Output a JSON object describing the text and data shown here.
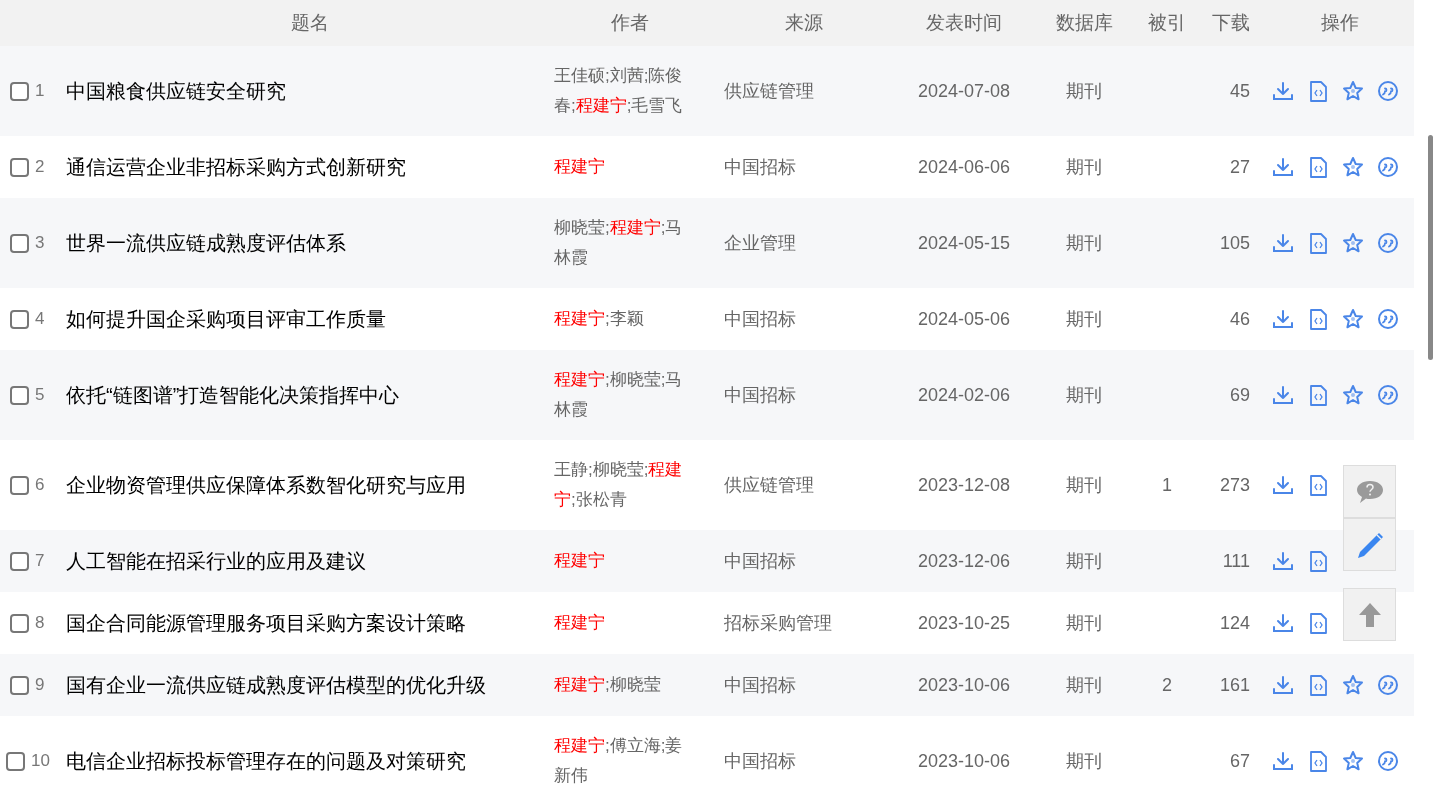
{
  "table": {
    "columns": [
      "题名",
      "作者",
      "来源",
      "发表时间",
      "数据库",
      "被引",
      "下载",
      "操作"
    ],
    "rows": [
      {
        "number": "1",
        "checked": false,
        "title": "中国粮食供应链安全研究",
        "authors": [
          {
            "text": "王佳硕;刘茜;陈俊春;",
            "highlight": false
          },
          {
            "text": "程建宁",
            "highlight": true
          },
          {
            "text": ";毛雪飞",
            "highlight": false
          }
        ],
        "source": "供应链管理",
        "date": "2024-07-08",
        "database": "期刊",
        "cited": "",
        "downloads": "45"
      },
      {
        "number": "2",
        "checked": false,
        "title": "通信运营企业非招标采购方式创新研究",
        "authors": [
          {
            "text": "程建宁",
            "highlight": true
          }
        ],
        "source": "中国招标",
        "date": "2024-06-06",
        "database": "期刊",
        "cited": "",
        "downloads": "27"
      },
      {
        "number": "3",
        "checked": false,
        "title": "世界一流供应链成熟度评估体系",
        "authors": [
          {
            "text": "柳晓莹;",
            "highlight": false
          },
          {
            "text": "程建宁",
            "highlight": true
          },
          {
            "text": ";马林霞",
            "highlight": false
          }
        ],
        "source": "企业管理",
        "date": "2024-05-15",
        "database": "期刊",
        "cited": "",
        "downloads": "105"
      },
      {
        "number": "4",
        "checked": false,
        "title": "如何提升国企采购项目评审工作质量",
        "authors": [
          {
            "text": "程建宁",
            "highlight": true
          },
          {
            "text": ";李颖",
            "highlight": false
          }
        ],
        "source": "中国招标",
        "date": "2024-05-06",
        "database": "期刊",
        "cited": "",
        "downloads": "46"
      },
      {
        "number": "5",
        "checked": false,
        "title": "依托“链图谱”打造智能化决策指挥中心",
        "authors": [
          {
            "text": "程建宁",
            "highlight": true
          },
          {
            "text": ";柳晓莹;马林霞",
            "highlight": false
          }
        ],
        "source": "中国招标",
        "date": "2024-02-06",
        "database": "期刊",
        "cited": "",
        "downloads": "69"
      },
      {
        "number": "6",
        "checked": false,
        "title": "企业物资管理供应保障体系数智化研究与应用",
        "authors": [
          {
            "text": "王静;柳晓莹;",
            "highlight": false
          },
          {
            "text": "程建宁",
            "highlight": true
          },
          {
            "text": ";张松青",
            "highlight": false
          }
        ],
        "source": "供应链管理",
        "date": "2023-12-08",
        "database": "期刊",
        "cited": "1",
        "downloads": "273"
      },
      {
        "number": "7",
        "checked": false,
        "title": "人工智能在招采行业的应用及建议",
        "authors": [
          {
            "text": "程建宁",
            "highlight": true
          }
        ],
        "source": "中国招标",
        "date": "2023-12-06",
        "database": "期刊",
        "cited": "",
        "downloads": "111"
      },
      {
        "number": "8",
        "checked": false,
        "title": "国企合同能源管理服务项目采购方案设计策略",
        "authors": [
          {
            "text": "程建宁",
            "highlight": true
          }
        ],
        "source": "招标采购管理",
        "date": "2023-10-25",
        "database": "期刊",
        "cited": "",
        "downloads": "124"
      },
      {
        "number": "9",
        "checked": false,
        "title": "国有企业一流供应链成熟度评估模型的优化升级",
        "authors": [
          {
            "text": "程建宁",
            "highlight": true
          },
          {
            "text": ";柳晓莹",
            "highlight": false
          }
        ],
        "source": "中国招标",
        "date": "2023-10-06",
        "database": "期刊",
        "cited": "2",
        "downloads": "161"
      },
      {
        "number": "10",
        "checked": false,
        "title": "电信企业招标投标管理存在的问题及对策研究",
        "authors": [
          {
            "text": "程建宁",
            "highlight": true
          },
          {
            "text": ";傅立海;姜新伟",
            "highlight": false
          }
        ],
        "source": "中国招标",
        "date": "2023-10-06",
        "database": "期刊",
        "cited": "",
        "downloads": "67"
      }
    ]
  },
  "float_buttons": [
    {
      "kind": "help"
    },
    {
      "kind": "edit"
    },
    {
      "kind": "top"
    }
  ]
}
